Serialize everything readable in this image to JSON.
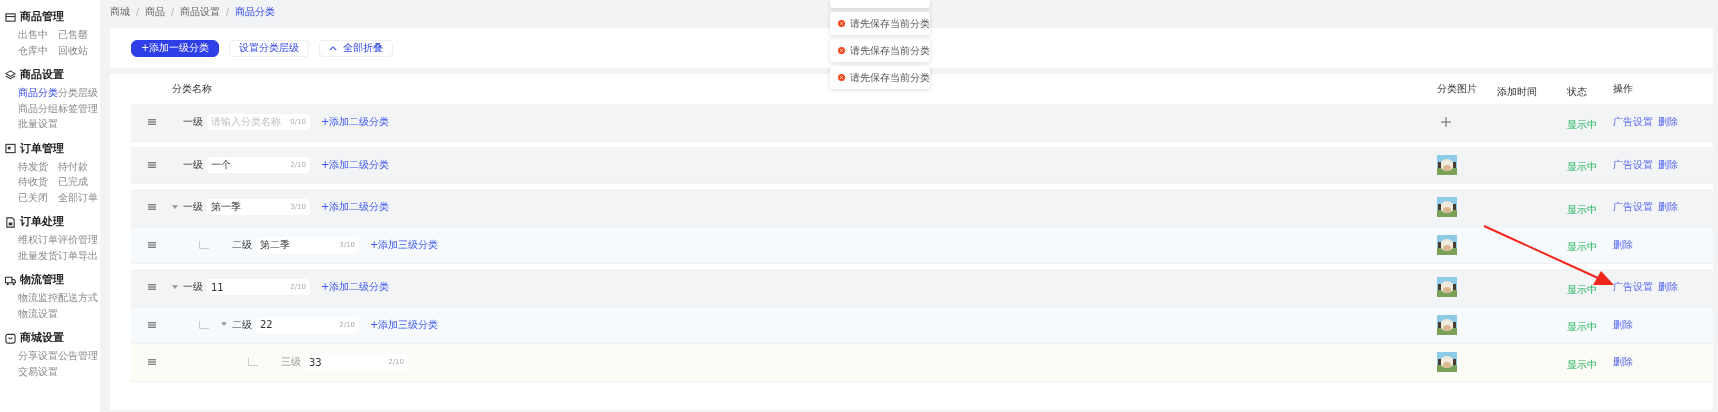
{
  "sidebar": {
    "groups": [
      {
        "title": "商品管理",
        "items": [
          {
            "label": "出售中",
            "selected": false
          },
          {
            "label": "已售罄",
            "selected": false
          },
          {
            "label": "仓库中",
            "selected": false
          },
          {
            "label": "回收站",
            "selected": false
          }
        ]
      },
      {
        "title": "商品设置",
        "items": [
          {
            "label": "商品分类",
            "selected": true
          },
          {
            "label": "分类层级",
            "selected": false
          },
          {
            "label": "商品分组",
            "selected": false
          },
          {
            "label": "标签管理",
            "selected": false
          },
          {
            "label": "批量设置",
            "selected": false
          }
        ]
      },
      {
        "title": "订单管理",
        "items": [
          {
            "label": "待发货",
            "selected": false
          },
          {
            "label": "待付款",
            "selected": false
          },
          {
            "label": "待收货",
            "selected": false
          },
          {
            "label": "已完成",
            "selected": false
          },
          {
            "label": "已关闭",
            "selected": false
          },
          {
            "label": "全部订单",
            "selected": false
          }
        ]
      },
      {
        "title": "订单处理",
        "items": [
          {
            "label": "维权订单",
            "selected": false
          },
          {
            "label": "评价管理",
            "selected": false
          },
          {
            "label": "批量发货",
            "selected": false
          },
          {
            "label": "订单导出",
            "selected": false
          }
        ]
      },
      {
        "title": "物流管理",
        "items": [
          {
            "label": "物流监控",
            "selected": false
          },
          {
            "label": "配送方式",
            "selected": false
          },
          {
            "label": "物流设置",
            "selected": false
          }
        ]
      },
      {
        "title": "商城设置",
        "items": [
          {
            "label": "分享设置",
            "selected": false
          },
          {
            "label": "公告管理",
            "selected": false
          },
          {
            "label": "交易设置",
            "selected": false
          }
        ]
      }
    ]
  },
  "breadcrumb": [
    {
      "label": "商城",
      "selected": false
    },
    {
      "label": "商品",
      "selected": false
    },
    {
      "label": "商品设置",
      "selected": false
    },
    {
      "label": "商品分类",
      "selected": true
    }
  ],
  "toolbar": [
    {
      "label": "+添加一级分类",
      "kind": "primary"
    },
    {
      "label": "设置分类层级",
      "kind": "default"
    },
    {
      "label": "全部折叠",
      "kind": "collapse"
    }
  ],
  "table": {
    "columns": [
      "分类名称",
      "分类图片",
      "添加时间",
      "状态",
      "操作"
    ],
    "rows": [
      {
        "level_label": "一级",
        "name": "",
        "placeholder": "请输入分类名称",
        "counter": "0/10",
        "add_link": "+添加二级分类",
        "image": false,
        "status": "显示中",
        "actions": [
          "广告设置",
          "删除"
        ]
      },
      {
        "level_label": "一级",
        "name": "一个",
        "counter": "2/10",
        "add_link": "+添加二级分类",
        "image": true,
        "status": "显示中",
        "actions": [
          "广告设置",
          "删除"
        ]
      },
      {
        "level_label": "一级",
        "name": "第一季",
        "counter": "3/10",
        "add_link": "+添加二级分类",
        "image": true,
        "status": "显示中",
        "actions": [
          "广告设置",
          "删除"
        ],
        "expanded": true,
        "children": [
          {
            "level_label": "二级",
            "name": "第二季",
            "counter": "3/10",
            "add_link": "+添加三级分类",
            "image": true,
            "status": "显示中",
            "actions": [
              "删除"
            ]
          }
        ]
      },
      {
        "level_label": "一级",
        "name": "11",
        "counter": "2/10",
        "add_link": "+添加二级分类",
        "image": true,
        "status": "显示中",
        "actions": [
          "广告设置",
          "删除"
        ],
        "expanded": true,
        "children": [
          {
            "level_label": "二级",
            "name": "22",
            "counter": "2/10",
            "add_link": "+添加三级分类",
            "image": true,
            "status": "显示中",
            "actions": [
              "删除"
            ],
            "expanded": true,
            "children": [
              {
                "level_label": "三级",
                "name": "33",
                "counter": "2/10",
                "image": true,
                "status": "显示中",
                "actions": [
                  "删除"
                ]
              }
            ]
          }
        ]
      }
    ]
  },
  "toasts": [
    {
      "text": "请先保存当前分类"
    },
    {
      "text": "请先保存当前分类"
    },
    {
      "text": "请先保存当前分类"
    }
  ]
}
